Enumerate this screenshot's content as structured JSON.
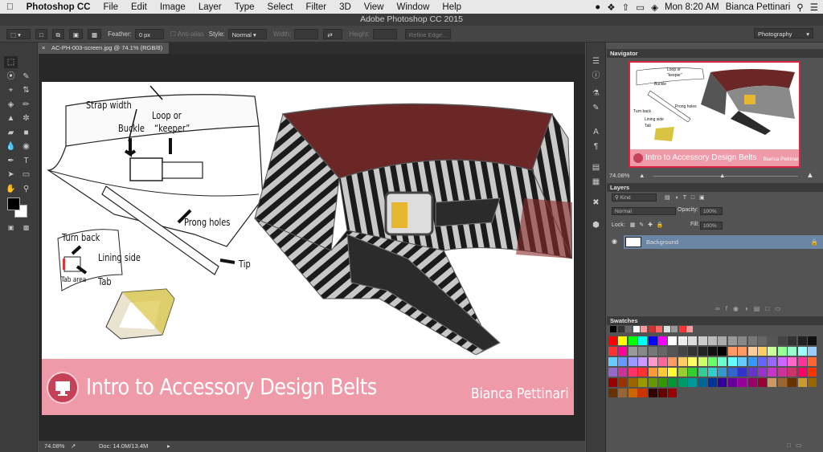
{
  "menubar": {
    "apple_icon": "apple-icon",
    "app_name": "Photoshop CC",
    "items": [
      "File",
      "Edit",
      "Image",
      "Layer",
      "Type",
      "Select",
      "Filter",
      "3D",
      "View",
      "Window",
      "Help"
    ],
    "clock": "Mon 8:20 AM",
    "user": "Bianca Pettinari"
  },
  "window_title": "Adobe Photoshop CC 2015",
  "options_bar": {
    "feather_label": "Feather:",
    "feather_value": "0 px",
    "antialias_label": "Anti-alias",
    "style_label": "Style:",
    "style_value": "Normal",
    "width_label": "Width:",
    "height_label": "Height:",
    "refine_label": "Refine Edge...",
    "workspace": "Photography"
  },
  "document": {
    "tab_label": "AC-PH-003-screen.jpg @ 74.1% (RGB/8)",
    "banner_title": "Intro to Accessory Design Belts",
    "banner_author": "Bianca Pettinari",
    "annotations": {
      "strap_width": "Strap width",
      "loop_keeper_1": "Loop or",
      "loop_keeper_2": "“keeper”",
      "buckle": "Buckle",
      "prong_holes": "Prong holes",
      "tip": "Tip",
      "turn_back": "Turn back",
      "lining_side": "Lining side",
      "tab": "Tab",
      "tab_area": "Tab area"
    },
    "accent_colors": {
      "pink": "#ef9aa9",
      "belt_red": "#6e2a2a"
    }
  },
  "status": {
    "zoom": "74.08%",
    "doc_info": "Doc: 14.0M/13.4M"
  },
  "navigator": {
    "title": "Navigator",
    "zoom": "74.08%",
    "thumb_title": "Intro to Accessory Design Belts",
    "thumb_author": "Bianca Pettinari",
    "thumb_labels": {
      "buckle": "Buckle",
      "loop": "Loop or",
      "keeper": "“keeper”",
      "prong": "Prong holes",
      "turn_back": "Turn back",
      "lining": "Lining side",
      "tab": "Tab"
    }
  },
  "layers": {
    "title": "Layers",
    "filter_kind": "Kind",
    "blend_mode": "Normal",
    "opacity_label": "Opacity:",
    "opacity_value": "100%",
    "lock_label": "Lock:",
    "fill_label": "Fill:",
    "fill_value": "100%",
    "layer_name": "Background"
  },
  "swatches": {
    "title": "Swatches"
  }
}
